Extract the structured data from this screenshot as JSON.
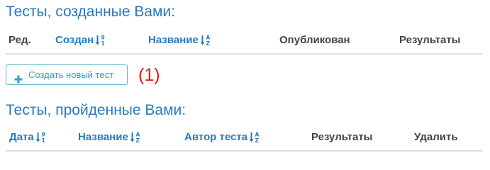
{
  "created_section": {
    "title": "Тесты, созданные Вами:",
    "columns": {
      "edit": "Ред.",
      "created": "Создан",
      "name": "Название",
      "published": "Опубликован",
      "results": "Результаты"
    },
    "create_button": {
      "label": "Создать новый тест",
      "icon": "plus-icon"
    },
    "marker": "(1)"
  },
  "passed_section": {
    "title": "Тесты, пройденные Вами:",
    "columns": {
      "date": "Дата",
      "name": "Название",
      "author": "Автор теста",
      "results": "Результаты",
      "delete": "Удалить"
    }
  },
  "colors": {
    "link_blue": "#2a7ab8",
    "button_border": "#58b5c9",
    "button_text": "#2fa2c0",
    "marker_red": "#e01b1b",
    "header_text": "#444444",
    "rule": "#dddddd"
  },
  "icons": {
    "numeric_sort": "sort-numeric-icon",
    "alpha_sort": "sort-alpha-icon"
  }
}
